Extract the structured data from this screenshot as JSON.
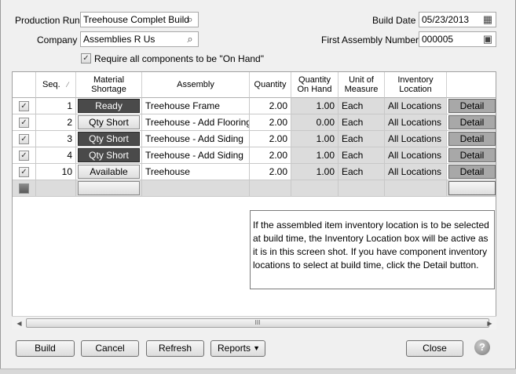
{
  "form": {
    "production_run_label": "Production Run",
    "production_run_value": "Treehouse Complet Build",
    "company_label": "Company",
    "company_value": "Assemblies R Us",
    "require_on_hand_label": "Require all components to be \"On Hand\"",
    "require_on_hand_checked": true,
    "build_date_label": "Build Date",
    "build_date_value": "05/23/2013",
    "first_assembly_label": "First Assembly Number",
    "first_assembly_value": "000005"
  },
  "grid": {
    "headers": {
      "seq": "Seq.",
      "material_shortage": "Material Shortage",
      "assembly": "Assembly",
      "quantity": "Quantity",
      "qty_on_hand": "Quantity On Hand",
      "uom": "Unit of Measure",
      "inv_location": "Inventory Location"
    },
    "rows": [
      {
        "checked": true,
        "seq": "1",
        "shortage": "Ready",
        "assembly": "Treehouse Frame",
        "quantity": "2.00",
        "on_hand": "1.00",
        "uom": "Each",
        "location": "All Locations",
        "detail": "Detail"
      },
      {
        "checked": true,
        "seq": "2",
        "shortage": "Qty Short",
        "assembly": "Treehouse - Add Flooring",
        "quantity": "2.00",
        "on_hand": "0.00",
        "uom": "Each",
        "location": "All Locations",
        "detail": "Detail"
      },
      {
        "checked": true,
        "seq": "3",
        "shortage": "Qty Short",
        "assembly": "Treehouse - Add Siding",
        "quantity": "2.00",
        "on_hand": "1.00",
        "uom": "Each",
        "location": "All Locations",
        "detail": "Detail"
      },
      {
        "checked": true,
        "seq": "4",
        "shortage": "Qty Short",
        "assembly": "Treehouse - Add Siding",
        "quantity": "2.00",
        "on_hand": "1.00",
        "uom": "Each",
        "location": "All Locations",
        "detail": "Detail"
      },
      {
        "checked": true,
        "seq": "10",
        "shortage": "Available",
        "assembly": "Treehouse",
        "quantity": "2.00",
        "on_hand": "1.00",
        "uom": "Each",
        "location": "All Locations",
        "detail": "Detail"
      }
    ]
  },
  "callout": "If the assembled item inventory location is to be selected at build time, the Inventory Location box will be active as it is in this screen shot. If you have component inventory locations to select at build time, click the Detail button.",
  "buttons": {
    "build": "Build",
    "cancel": "Cancel",
    "refresh": "Refresh",
    "reports": "Reports",
    "close": "Close"
  },
  "icons": {
    "lookup": "magnifier-icon",
    "calendar": "calendar-icon",
    "help": "help-icon",
    "sort": "sort-icon"
  }
}
